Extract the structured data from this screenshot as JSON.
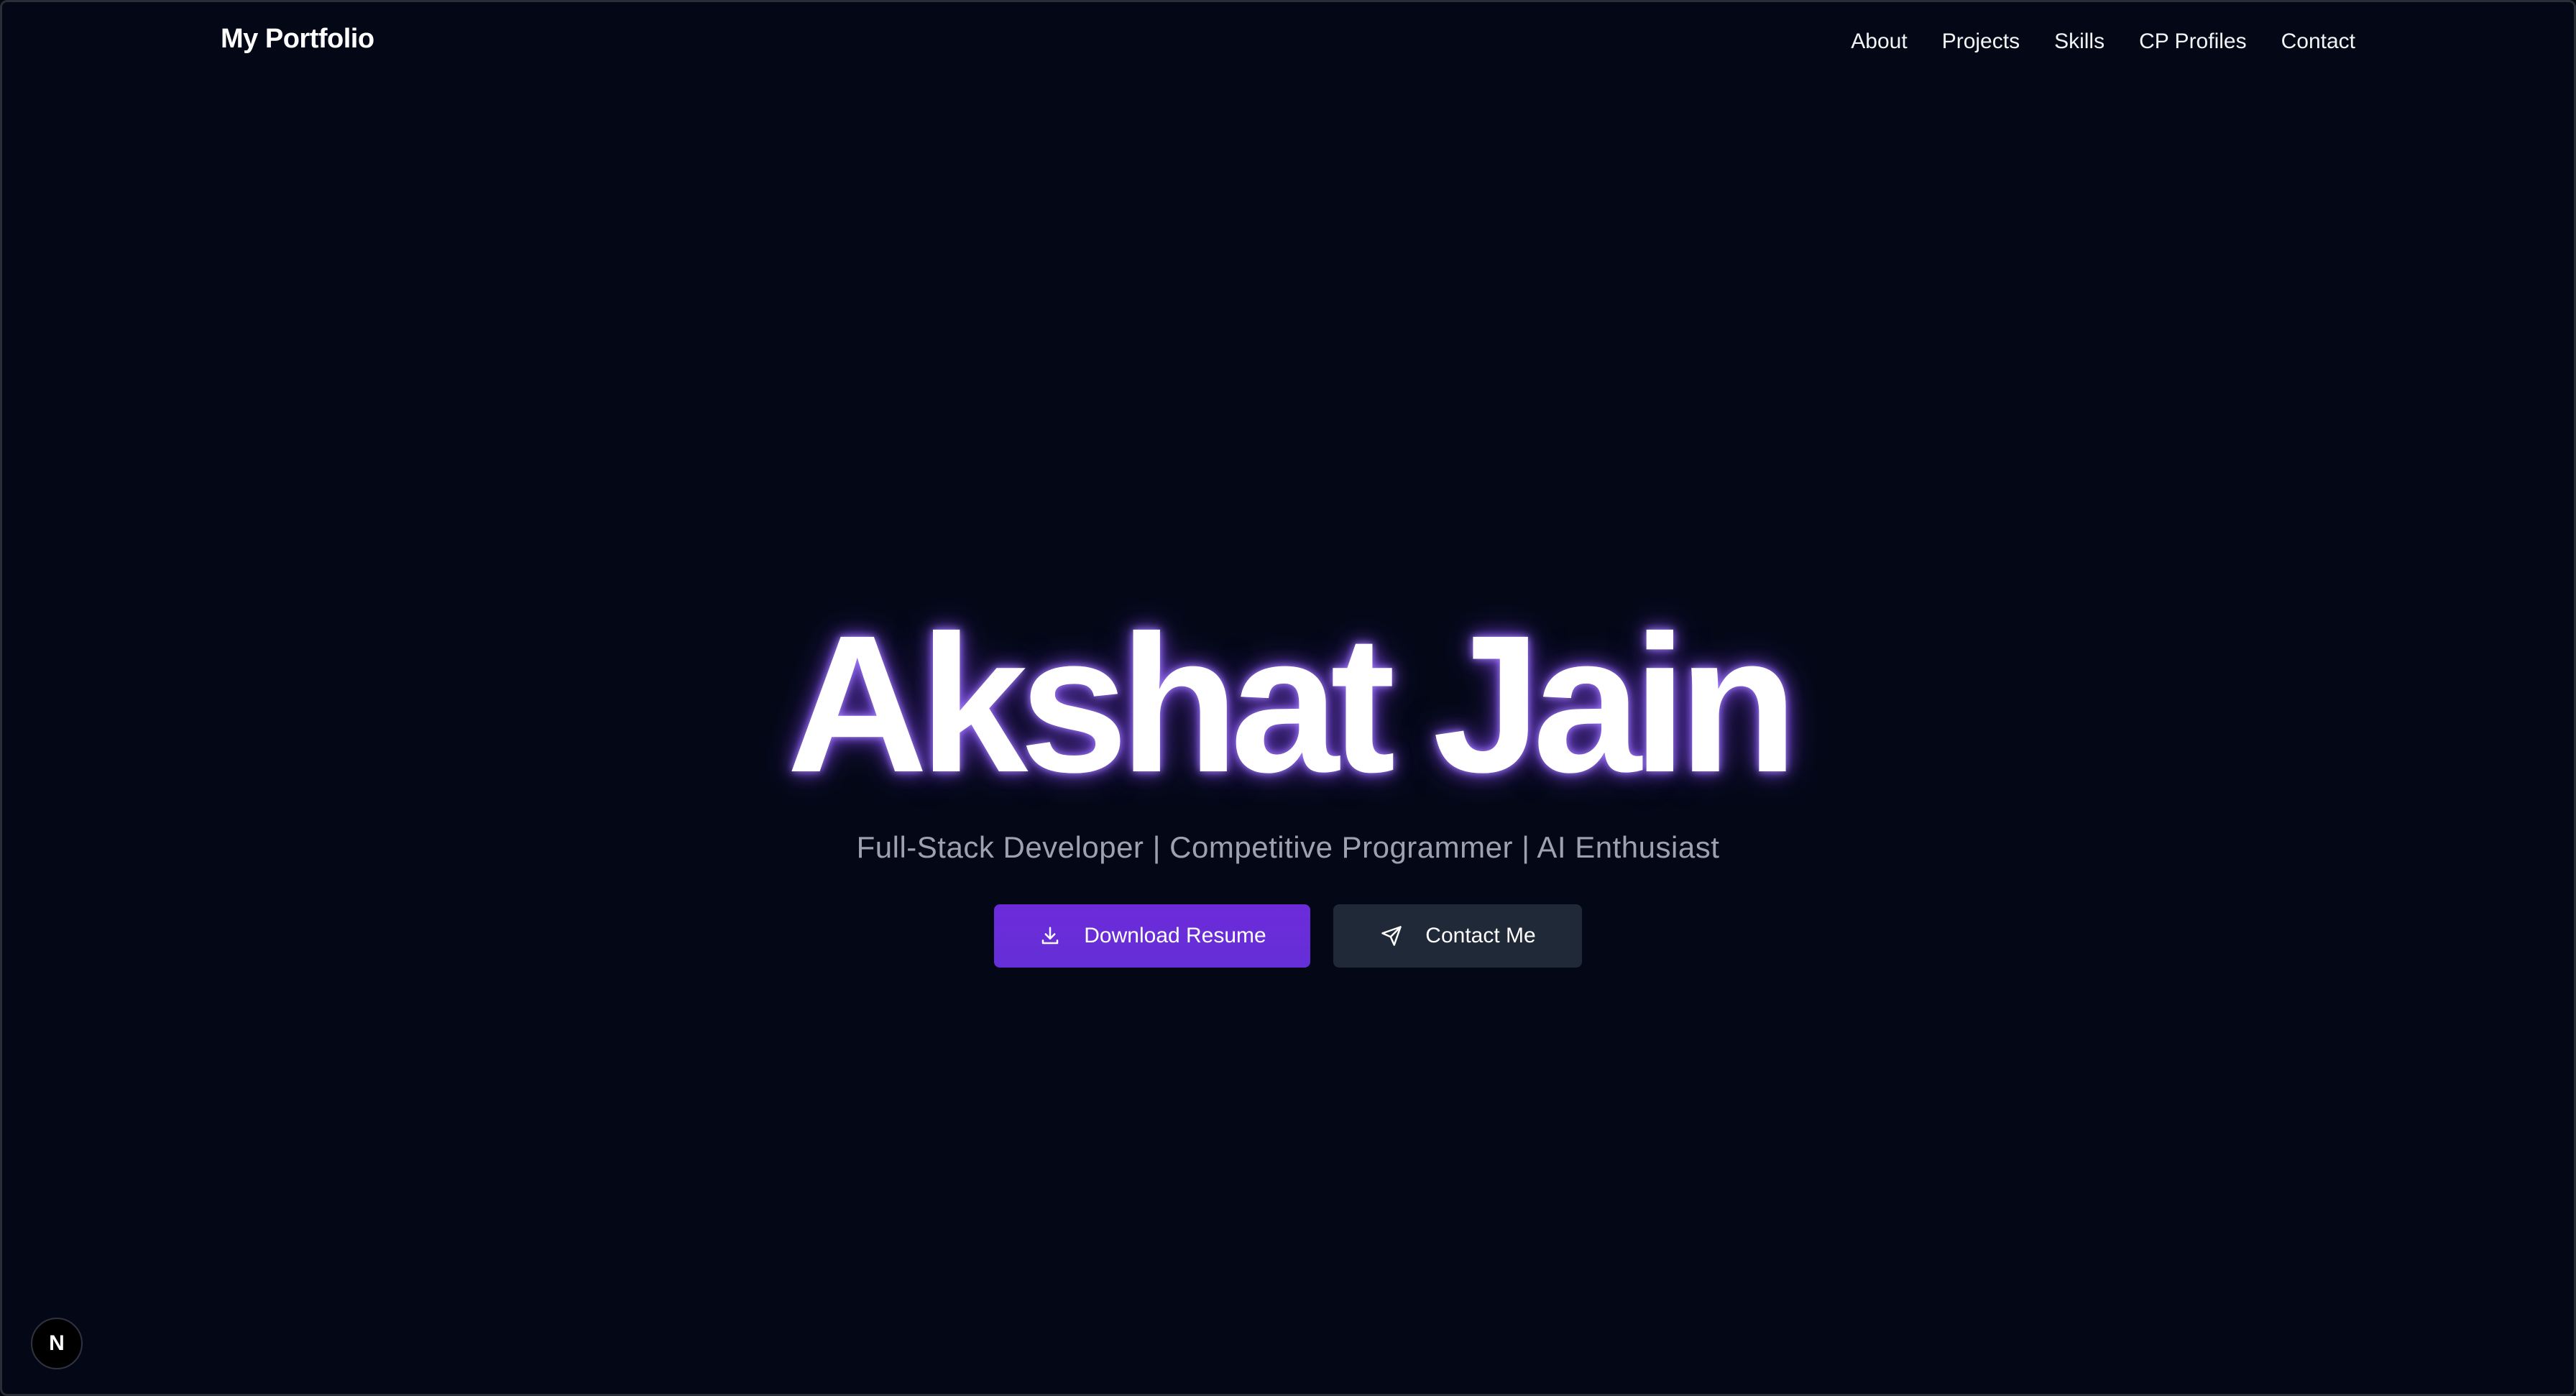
{
  "brand": {
    "title": "My Portfolio"
  },
  "nav": {
    "items": [
      {
        "label": "About"
      },
      {
        "label": "Projects"
      },
      {
        "label": "Skills"
      },
      {
        "label": "CP Profiles"
      },
      {
        "label": "Contact"
      }
    ]
  },
  "hero": {
    "name": "Akshat Jain",
    "subtitle": "Full-Stack Developer | Competitive Programmer | AI Enthusiast",
    "primary_button": {
      "label": "Download Resume",
      "icon": "download-icon"
    },
    "secondary_button": {
      "label": "Contact Me",
      "icon": "send-icon"
    }
  },
  "floating_badge": {
    "label": "N",
    "icon": "nextjs-icon"
  },
  "colors": {
    "background": "#040816",
    "accent": "#6d28d9",
    "secondary_button": "#1f2937",
    "subtitle": "#9ca3af",
    "glow": "#8b5cf6"
  }
}
